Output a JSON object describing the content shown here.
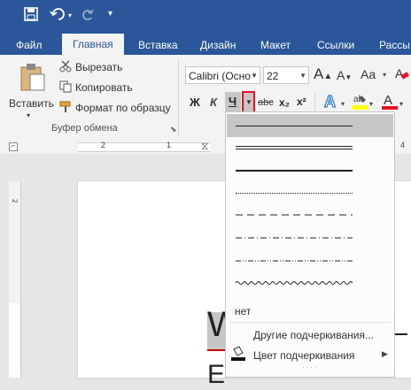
{
  "quick_access": {
    "save_icon": "save-icon",
    "undo_icon": "undo-icon",
    "redo_icon": "redo-icon",
    "customize_icon": "customize-icon"
  },
  "tabs": [
    {
      "label": "Файл"
    },
    {
      "label": "Главная"
    },
    {
      "label": "Вставка"
    },
    {
      "label": "Дизайн"
    },
    {
      "label": "Макет"
    },
    {
      "label": "Ссылки"
    },
    {
      "label": "Рассы"
    }
  ],
  "clipboard": {
    "paste_label": "Вставить",
    "cut_label": "Вырезать",
    "copy_label": "Копировать",
    "format_painter_label": "Формат по образцу",
    "group_label": "Буфер обмена"
  },
  "font": {
    "name": "Calibri (Осно",
    "size": "22",
    "bold": "Ж",
    "italic": "К",
    "underline": "Ч",
    "strikethrough": "abc",
    "subscript": "x₂",
    "superscript": "x²",
    "effects_icon": "text-effects-icon",
    "highlight_icon": "highlight-icon",
    "font_color_icon": "font-color-icon",
    "grow_letter": "A"
  },
  "ruler": {
    "left_num": "2",
    "right_num": "1",
    "edge_num": "4"
  },
  "vruler": {
    "num": "2"
  },
  "document": {
    "visible_text": "W",
    "lower_text": "E"
  },
  "underline_menu": {
    "styles": [
      "single",
      "double",
      "thick",
      "dotted",
      "dashed",
      "dash-dot",
      "dash-dot-dot",
      "wave"
    ],
    "none_label": "нет",
    "more_label": "Другие подчеркивания...",
    "color_label": "Цвет подчеркивания",
    "colors": {
      "accent": "#2b579a",
      "selected": "#c6c6c6",
      "highlight_red": "#e81123"
    }
  }
}
